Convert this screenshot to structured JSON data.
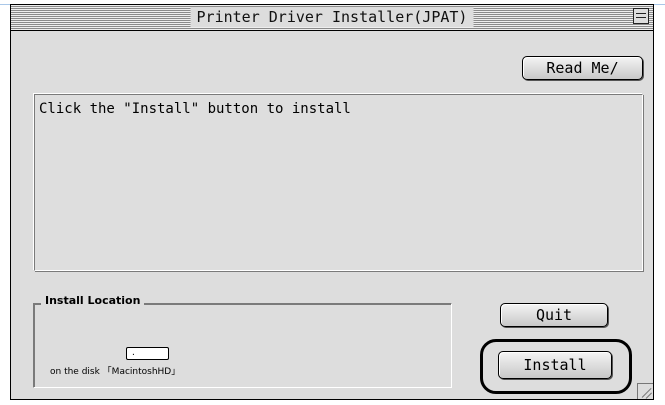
{
  "window": {
    "title": "Printer Driver Installer(JPAT)"
  },
  "buttons": {
    "readme_label": "Read Me/",
    "quit_label": "Quit",
    "install_label": "Install"
  },
  "message": {
    "text": "Click the \"Install\" button to install"
  },
  "install_location": {
    "group_label": "Install Location",
    "field_value": ".",
    "disk_text": "on the disk 「MacintoshHD」"
  },
  "icons": {
    "zoom": "zoom-box-icon",
    "resize": "grow-box-icon"
  },
  "colors": {
    "window_bg": "#dddddd",
    "border": "#000000"
  }
}
